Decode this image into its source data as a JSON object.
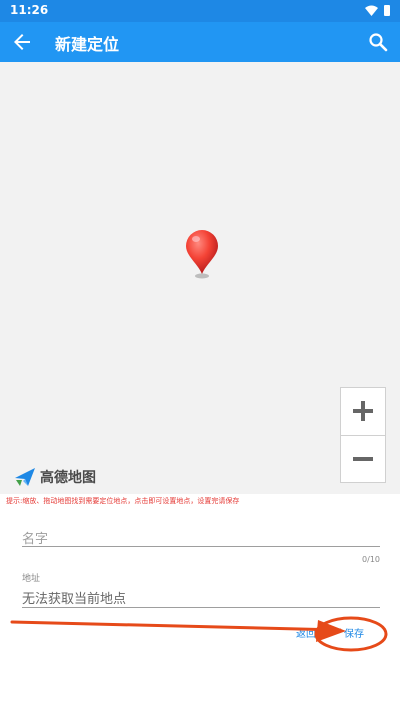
{
  "status": {
    "time": "11:26"
  },
  "appbar": {
    "title": "新建定位"
  },
  "map": {
    "provider": "高德地图"
  },
  "hint": "提示:缩放、拖动地图找到需要定位地点，点击即可设置地点，设置完请保存",
  "form": {
    "name_placeholder": "名字",
    "name_counter": "0/10",
    "address_label": "地址",
    "address_value": "无法获取当前地点"
  },
  "actions": {
    "back_label": "返回",
    "save_label": "保存"
  },
  "icons": [
    "back-arrow-icon",
    "search-icon",
    "wifi-icon",
    "battery-icon",
    "location-marker-icon",
    "zoom-in-icon",
    "zoom-out-icon",
    "amap-logo-icon"
  ],
  "colors": {
    "appbar": "#2196f3",
    "statusbar": "#1e88e5",
    "hint": "#e53935",
    "annotation": "#e64a19"
  }
}
